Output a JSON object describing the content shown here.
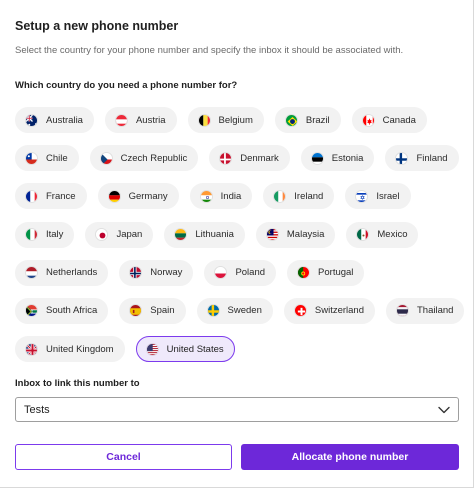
{
  "dialog": {
    "title": "Setup a new phone number",
    "subtitle": "Select the country for your phone number and specify the inbox it should be associated with.",
    "country_question": "Which country do you need a phone number for?",
    "selected_country": "United States"
  },
  "countries": [
    [
      {
        "label": "Australia",
        "flag": "au"
      },
      {
        "label": "Austria",
        "flag": "at"
      },
      {
        "label": "Belgium",
        "flag": "be"
      },
      {
        "label": "Brazil",
        "flag": "br"
      },
      {
        "label": "Canada",
        "flag": "ca"
      }
    ],
    [
      {
        "label": "Chile",
        "flag": "cl"
      },
      {
        "label": "Czech Republic",
        "flag": "cz"
      },
      {
        "label": "Denmark",
        "flag": "dk"
      },
      {
        "label": "Estonia",
        "flag": "ee"
      },
      {
        "label": "Finland",
        "flag": "fi"
      }
    ],
    [
      {
        "label": "France",
        "flag": "fr"
      },
      {
        "label": "Germany",
        "flag": "de"
      },
      {
        "label": "India",
        "flag": "in"
      },
      {
        "label": "Ireland",
        "flag": "ie"
      },
      {
        "label": "Israel",
        "flag": "il"
      }
    ],
    [
      {
        "label": "Italy",
        "flag": "it"
      },
      {
        "label": "Japan",
        "flag": "jp"
      },
      {
        "label": "Lithuania",
        "flag": "lt"
      },
      {
        "label": "Malaysia",
        "flag": "my"
      },
      {
        "label": "Mexico",
        "flag": "mx"
      }
    ],
    [
      {
        "label": "Netherlands",
        "flag": "nl"
      },
      {
        "label": "Norway",
        "flag": "no"
      },
      {
        "label": "Poland",
        "flag": "pl"
      },
      {
        "label": "Portugal",
        "flag": "pt"
      }
    ],
    [
      {
        "label": "South Africa",
        "flag": "za"
      },
      {
        "label": "Spain",
        "flag": "es"
      },
      {
        "label": "Sweden",
        "flag": "se"
      },
      {
        "label": "Switzerland",
        "flag": "ch"
      },
      {
        "label": "Thailand",
        "flag": "th"
      }
    ],
    [
      {
        "label": "United Kingdom",
        "flag": "gb"
      },
      {
        "label": "United States",
        "flag": "us"
      }
    ]
  ],
  "inbox": {
    "label": "Inbox to link this number to",
    "selected_value": "Tests"
  },
  "buttons": {
    "cancel_label": "Cancel",
    "allocate_label": "Allocate phone number"
  },
  "colors": {
    "accent": "#6d28d9",
    "selected_chip_bg": "#efe9fb",
    "chip_bg": "#f2f2f2"
  }
}
